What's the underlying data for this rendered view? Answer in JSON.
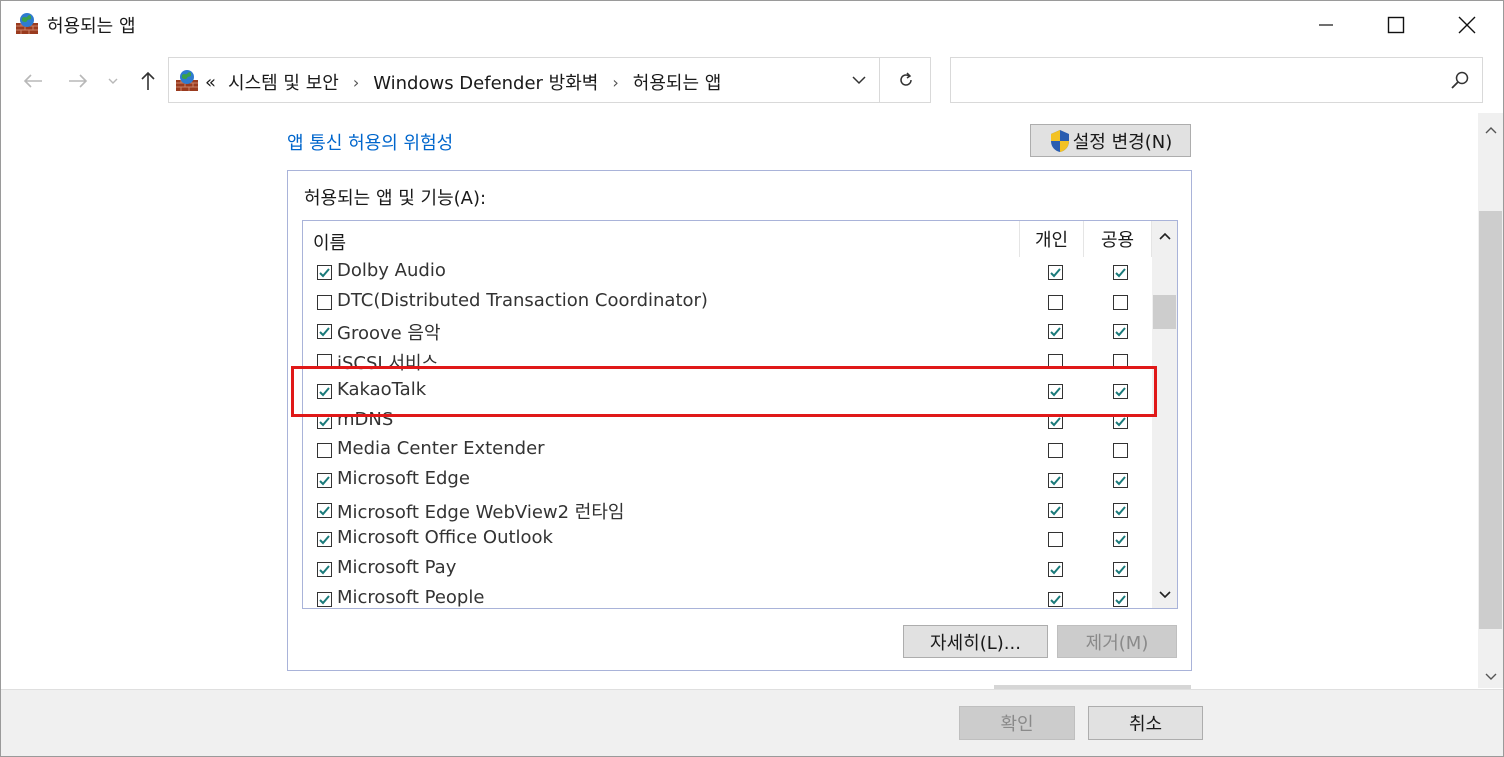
{
  "window": {
    "title": "허용되는 앱"
  },
  "address": {
    "prefix": "«",
    "crumbs": [
      "시스템 및 보안",
      "Windows Defender 방화벽",
      "허용되는 앱"
    ],
    "separator": "›"
  },
  "search": {
    "placeholder": ""
  },
  "content": {
    "risk_link": "앱 통신 허용의 위험성",
    "change_settings": "설정 변경(N)",
    "group_label": "허용되는 앱 및 기능(A):",
    "columns": {
      "name": "이름",
      "private": "개인",
      "public": "공용"
    },
    "rows": [
      {
        "name": "Dolby Audio",
        "enabled": true,
        "private": true,
        "public": true
      },
      {
        "name": "DTC(Distributed Transaction Coordinator)",
        "enabled": false,
        "private": false,
        "public": false
      },
      {
        "name": "Groove 음악",
        "enabled": true,
        "private": true,
        "public": true
      },
      {
        "name": "iSCSI 서비스",
        "enabled": false,
        "private": false,
        "public": false
      },
      {
        "name": "KakaoTalk",
        "enabled": true,
        "private": true,
        "public": true
      },
      {
        "name": "mDNS",
        "enabled": true,
        "private": true,
        "public": true
      },
      {
        "name": "Media Center Extender",
        "enabled": false,
        "private": false,
        "public": false
      },
      {
        "name": "Microsoft Edge",
        "enabled": true,
        "private": true,
        "public": true
      },
      {
        "name": "Microsoft Edge WebView2 런타임",
        "enabled": true,
        "private": true,
        "public": true
      },
      {
        "name": "Microsoft Office Outlook",
        "enabled": true,
        "private": false,
        "public": true
      },
      {
        "name": "Microsoft Pay",
        "enabled": true,
        "private": true,
        "public": true
      },
      {
        "name": "Microsoft People",
        "enabled": true,
        "private": true,
        "public": true
      }
    ],
    "details_button": "자세히(L)...",
    "remove_button": "제거(M)"
  },
  "footer": {
    "ok_button": "확인",
    "cancel_button": "취소"
  },
  "colors": {
    "link": "#0066cc",
    "highlight": "#e01818",
    "check": "#1a7a7a"
  }
}
